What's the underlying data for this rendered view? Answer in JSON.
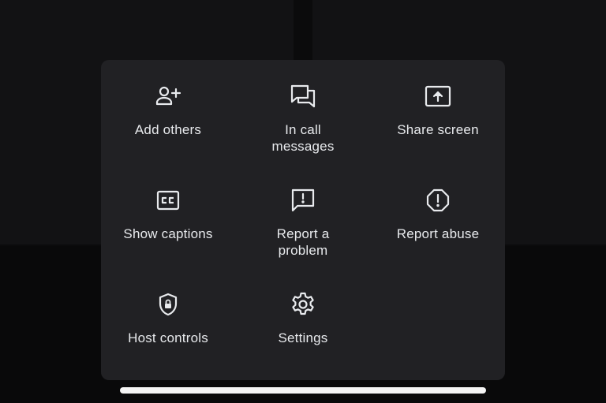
{
  "menu": {
    "items": [
      {
        "label": "Add others",
        "icon": "add-person-icon"
      },
      {
        "label": "In call\nmessages",
        "icon": "chat-messages-icon"
      },
      {
        "label": "Share screen",
        "icon": "present-screen-icon"
      },
      {
        "label": "Show captions",
        "icon": "closed-captions-icon"
      },
      {
        "label": "Report a\nproblem",
        "icon": "feedback-icon"
      },
      {
        "label": "Report abuse",
        "icon": "report-icon"
      },
      {
        "label": "Host controls",
        "icon": "shield-lock-icon"
      },
      {
        "label": "Settings",
        "icon": "gear-icon"
      }
    ]
  },
  "colors": {
    "sheet_background": "#212124",
    "text": "#e8eaed",
    "page_background": "#0b0b0c"
  }
}
